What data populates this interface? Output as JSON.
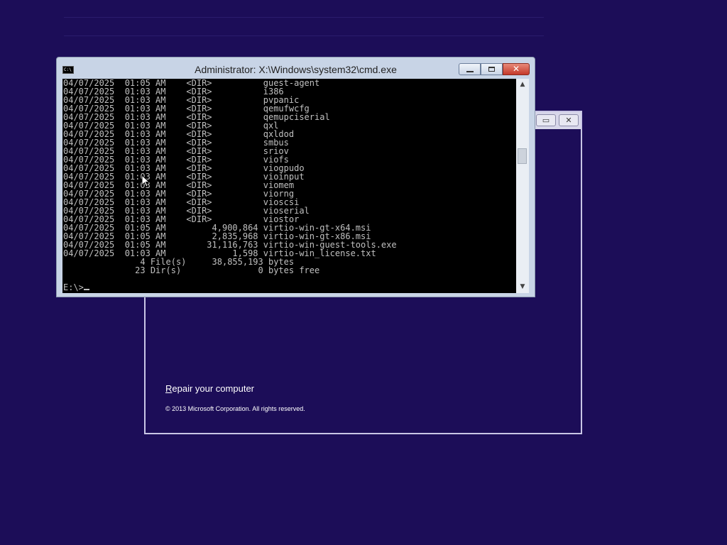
{
  "cmd": {
    "title": "Administrator: X:\\Windows\\system32\\cmd.exe",
    "icon": "cmd-icon",
    "lines": [
      "04/07/2025  01:05 AM    <DIR>          guest-agent",
      "04/07/2025  01:03 AM    <DIR>          i386",
      "04/07/2025  01:03 AM    <DIR>          pvpanic",
      "04/07/2025  01:03 AM    <DIR>          qemufwcfg",
      "04/07/2025  01:03 AM    <DIR>          qemupciserial",
      "04/07/2025  01:03 AM    <DIR>          qxl",
      "04/07/2025  01:03 AM    <DIR>          qxldod",
      "04/07/2025  01:03 AM    <DIR>          smbus",
      "04/07/2025  01:03 AM    <DIR>          sriov",
      "04/07/2025  01:03 AM    <DIR>          viofs",
      "04/07/2025  01:03 AM    <DIR>          viogpudo",
      "04/07/2025  01:03 AM    <DIR>          vioinput",
      "04/07/2025  01:03 AM    <DIR>          viomem",
      "04/07/2025  01:03 AM    <DIR>          viorng",
      "04/07/2025  01:03 AM    <DIR>          vioscsi",
      "04/07/2025  01:03 AM    <DIR>          vioserial",
      "04/07/2025  01:03 AM    <DIR>          viostor",
      "04/07/2025  01:05 AM         4,900,864 virtio-win-gt-x64.msi",
      "04/07/2025  01:05 AM         2,835,968 virtio-win-gt-x86.msi",
      "04/07/2025  01:05 AM        31,116,763 virtio-win-guest-tools.exe",
      "04/07/2025  01:03 AM             1,598 virtio-win_license.txt",
      "               4 File(s)     38,855,193 bytes",
      "              23 Dir(s)               0 bytes free",
      "",
      "E:\\>"
    ]
  },
  "setup": {
    "repair_link_first": "R",
    "repair_link_rest": "epair your computer",
    "copyright": "© 2013 Microsoft Corporation. All rights reserved."
  },
  "colors": {
    "desktop": "#1c0d58",
    "console_bg": "#000000",
    "console_fg": "#c0c0c0"
  }
}
